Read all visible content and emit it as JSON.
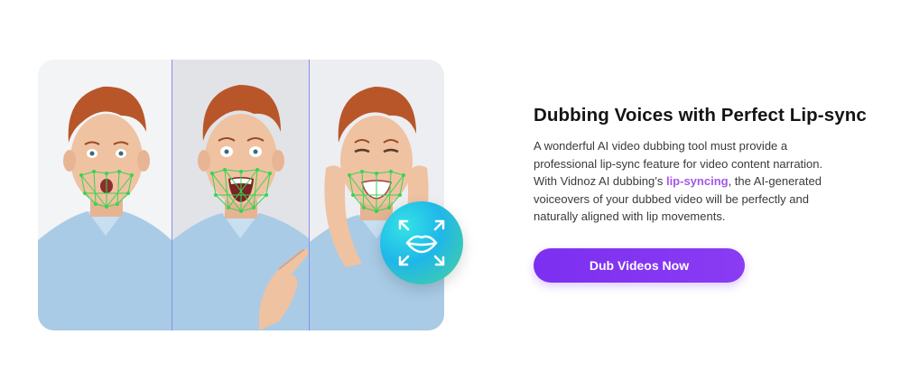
{
  "feature": {
    "heading": "Dubbing Voices with Perfect Lip-sync",
    "description": {
      "part1": "A wonderful AI video dubbing tool must provide a professional lip-sync feature for video content narration. With Vidnoz AI dubbing’s ",
      "link": "lip-syncing",
      "part2": ", the AI-generated voiceovers of your dubbed video will be perfectly and naturally aligned with lip movements."
    },
    "cta_label": "Dub Videos Now"
  },
  "media": {
    "frames": [
      "face-surprised",
      "face-excited-pointing",
      "face-smiling-hands"
    ],
    "badge_icon": "lips-expand-icon",
    "colors": {
      "mesh": "#39d353",
      "hair": "#b8562a",
      "shirt": "#a9cbe6",
      "skin": "#efc2a2",
      "divider": "#8b8ef0"
    }
  },
  "colors": {
    "accent": "#7c2ff0",
    "link": "#a259e6",
    "heading": "#141414",
    "body_text": "#3a3a3a"
  }
}
